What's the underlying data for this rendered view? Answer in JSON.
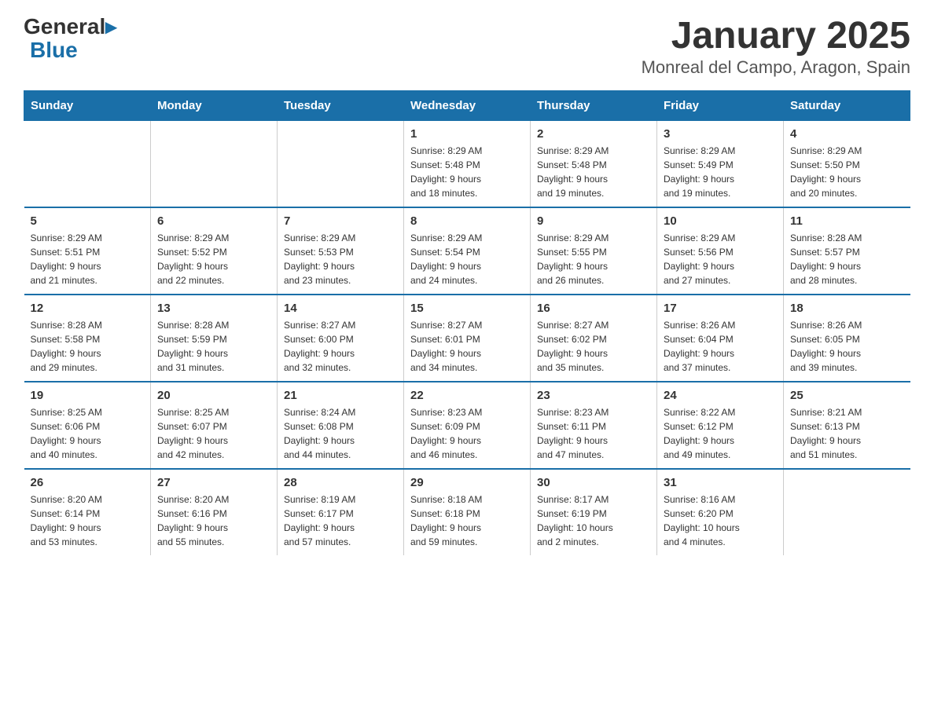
{
  "logo": {
    "general": "General",
    "blue": "Blue"
  },
  "title": "January 2025",
  "subtitle": "Monreal del Campo, Aragon, Spain",
  "headers": [
    "Sunday",
    "Monday",
    "Tuesday",
    "Wednesday",
    "Thursday",
    "Friday",
    "Saturday"
  ],
  "weeks": [
    [
      {
        "num": "",
        "info": ""
      },
      {
        "num": "",
        "info": ""
      },
      {
        "num": "",
        "info": ""
      },
      {
        "num": "1",
        "info": "Sunrise: 8:29 AM\nSunset: 5:48 PM\nDaylight: 9 hours\nand 18 minutes."
      },
      {
        "num": "2",
        "info": "Sunrise: 8:29 AM\nSunset: 5:48 PM\nDaylight: 9 hours\nand 19 minutes."
      },
      {
        "num": "3",
        "info": "Sunrise: 8:29 AM\nSunset: 5:49 PM\nDaylight: 9 hours\nand 19 minutes."
      },
      {
        "num": "4",
        "info": "Sunrise: 8:29 AM\nSunset: 5:50 PM\nDaylight: 9 hours\nand 20 minutes."
      }
    ],
    [
      {
        "num": "5",
        "info": "Sunrise: 8:29 AM\nSunset: 5:51 PM\nDaylight: 9 hours\nand 21 minutes."
      },
      {
        "num": "6",
        "info": "Sunrise: 8:29 AM\nSunset: 5:52 PM\nDaylight: 9 hours\nand 22 minutes."
      },
      {
        "num": "7",
        "info": "Sunrise: 8:29 AM\nSunset: 5:53 PM\nDaylight: 9 hours\nand 23 minutes."
      },
      {
        "num": "8",
        "info": "Sunrise: 8:29 AM\nSunset: 5:54 PM\nDaylight: 9 hours\nand 24 minutes."
      },
      {
        "num": "9",
        "info": "Sunrise: 8:29 AM\nSunset: 5:55 PM\nDaylight: 9 hours\nand 26 minutes."
      },
      {
        "num": "10",
        "info": "Sunrise: 8:29 AM\nSunset: 5:56 PM\nDaylight: 9 hours\nand 27 minutes."
      },
      {
        "num": "11",
        "info": "Sunrise: 8:28 AM\nSunset: 5:57 PM\nDaylight: 9 hours\nand 28 minutes."
      }
    ],
    [
      {
        "num": "12",
        "info": "Sunrise: 8:28 AM\nSunset: 5:58 PM\nDaylight: 9 hours\nand 29 minutes."
      },
      {
        "num": "13",
        "info": "Sunrise: 8:28 AM\nSunset: 5:59 PM\nDaylight: 9 hours\nand 31 minutes."
      },
      {
        "num": "14",
        "info": "Sunrise: 8:27 AM\nSunset: 6:00 PM\nDaylight: 9 hours\nand 32 minutes."
      },
      {
        "num": "15",
        "info": "Sunrise: 8:27 AM\nSunset: 6:01 PM\nDaylight: 9 hours\nand 34 minutes."
      },
      {
        "num": "16",
        "info": "Sunrise: 8:27 AM\nSunset: 6:02 PM\nDaylight: 9 hours\nand 35 minutes."
      },
      {
        "num": "17",
        "info": "Sunrise: 8:26 AM\nSunset: 6:04 PM\nDaylight: 9 hours\nand 37 minutes."
      },
      {
        "num": "18",
        "info": "Sunrise: 8:26 AM\nSunset: 6:05 PM\nDaylight: 9 hours\nand 39 minutes."
      }
    ],
    [
      {
        "num": "19",
        "info": "Sunrise: 8:25 AM\nSunset: 6:06 PM\nDaylight: 9 hours\nand 40 minutes."
      },
      {
        "num": "20",
        "info": "Sunrise: 8:25 AM\nSunset: 6:07 PM\nDaylight: 9 hours\nand 42 minutes."
      },
      {
        "num": "21",
        "info": "Sunrise: 8:24 AM\nSunset: 6:08 PM\nDaylight: 9 hours\nand 44 minutes."
      },
      {
        "num": "22",
        "info": "Sunrise: 8:23 AM\nSunset: 6:09 PM\nDaylight: 9 hours\nand 46 minutes."
      },
      {
        "num": "23",
        "info": "Sunrise: 8:23 AM\nSunset: 6:11 PM\nDaylight: 9 hours\nand 47 minutes."
      },
      {
        "num": "24",
        "info": "Sunrise: 8:22 AM\nSunset: 6:12 PM\nDaylight: 9 hours\nand 49 minutes."
      },
      {
        "num": "25",
        "info": "Sunrise: 8:21 AM\nSunset: 6:13 PM\nDaylight: 9 hours\nand 51 minutes."
      }
    ],
    [
      {
        "num": "26",
        "info": "Sunrise: 8:20 AM\nSunset: 6:14 PM\nDaylight: 9 hours\nand 53 minutes."
      },
      {
        "num": "27",
        "info": "Sunrise: 8:20 AM\nSunset: 6:16 PM\nDaylight: 9 hours\nand 55 minutes."
      },
      {
        "num": "28",
        "info": "Sunrise: 8:19 AM\nSunset: 6:17 PM\nDaylight: 9 hours\nand 57 minutes."
      },
      {
        "num": "29",
        "info": "Sunrise: 8:18 AM\nSunset: 6:18 PM\nDaylight: 9 hours\nand 59 minutes."
      },
      {
        "num": "30",
        "info": "Sunrise: 8:17 AM\nSunset: 6:19 PM\nDaylight: 10 hours\nand 2 minutes."
      },
      {
        "num": "31",
        "info": "Sunrise: 8:16 AM\nSunset: 6:20 PM\nDaylight: 10 hours\nand 4 minutes."
      },
      {
        "num": "",
        "info": ""
      }
    ]
  ]
}
